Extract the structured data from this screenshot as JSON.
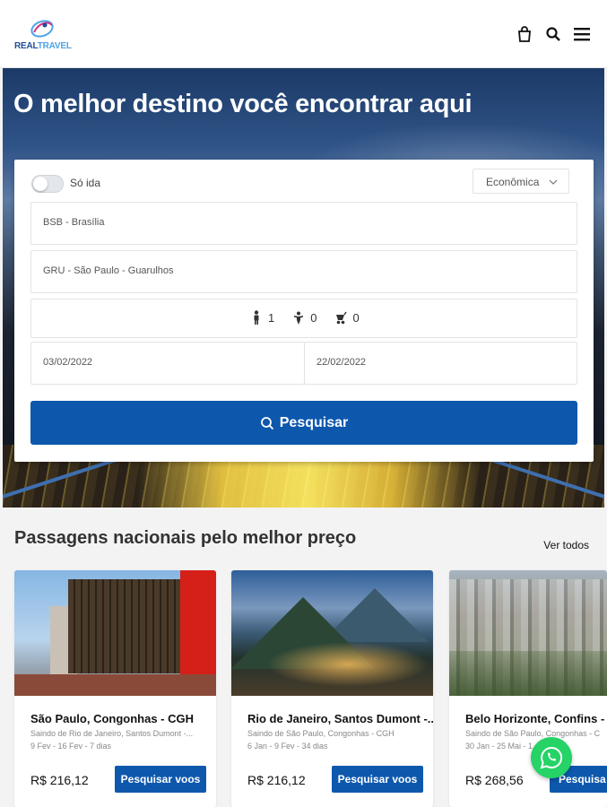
{
  "brand": {
    "logo_text_a": "REAL",
    "logo_text_b": "TRAVEL",
    "primary_color": "#0d58ad"
  },
  "header": {
    "icons": [
      "shopping-bag-icon",
      "search-icon",
      "menu-icon"
    ]
  },
  "hero": {
    "title": "O melhor destino você encontrar aqui"
  },
  "search_form": {
    "one_way_label": "Só ida",
    "one_way_enabled": false,
    "cabin_class": "Econômica",
    "origin": "BSB - Brasília",
    "destination": "GRU - São Paulo - Guarulhos",
    "passengers": {
      "adults": "1",
      "children": "0",
      "infants": "0"
    },
    "departure_date": "03/02/2022",
    "return_date": "22/02/2022",
    "submit_label": "Pesquisar"
  },
  "section": {
    "title": "Passagens nacionais pelo melhor preço",
    "see_all_label": "Ver todos"
  },
  "deals": [
    {
      "title": "São Paulo, Congonhas - CGH",
      "subtitle": "Saindo de Rio de Janeiro, Santos Dumont -...",
      "dates": "9 Fev - 16 Fev - 7 dias",
      "price": "R$ 216,12",
      "button_label": "Pesquisar voos"
    },
    {
      "title": "Rio de Janeiro, Santos Dumont -...",
      "subtitle": "Saindo de São Paulo, Congonhas - CGH",
      "dates": "6 Jan - 9 Fev - 34 dias",
      "price": "R$ 216,12",
      "button_label": "Pesquisar voos"
    },
    {
      "title": "Belo Horizonte, Confins - C",
      "subtitle": "Saindo de São Paulo, Congonhas - C",
      "dates": "30 Jan - 25 Mai - 1",
      "price": "R$ 268,56",
      "button_label": "Pesquisa"
    }
  ],
  "whatsapp": {
    "icon": "whatsapp-icon",
    "color": "#25d366"
  }
}
